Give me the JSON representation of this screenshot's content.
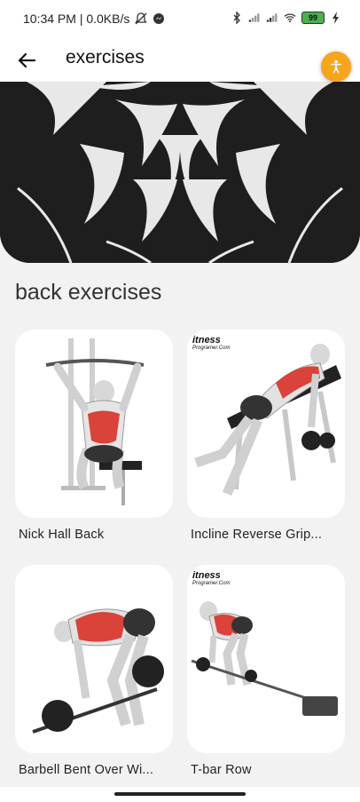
{
  "status_bar": {
    "time_speed": "10:34 PM | 0.0KB/s",
    "battery": "99"
  },
  "app_bar": {
    "title": "exercises"
  },
  "section": {
    "title": "back exercises"
  },
  "exercises": [
    {
      "name": "Nick Hall Back"
    },
    {
      "name": "Incline Reverse Grip..."
    },
    {
      "name": "Barbell Bent Over Wi..."
    },
    {
      "name": "T-bar Row"
    }
  ],
  "colors": {
    "accent_fab": "#f7a51b",
    "hero_bg": "#1e1e1e",
    "muscle_highlight": "#d9433a"
  }
}
